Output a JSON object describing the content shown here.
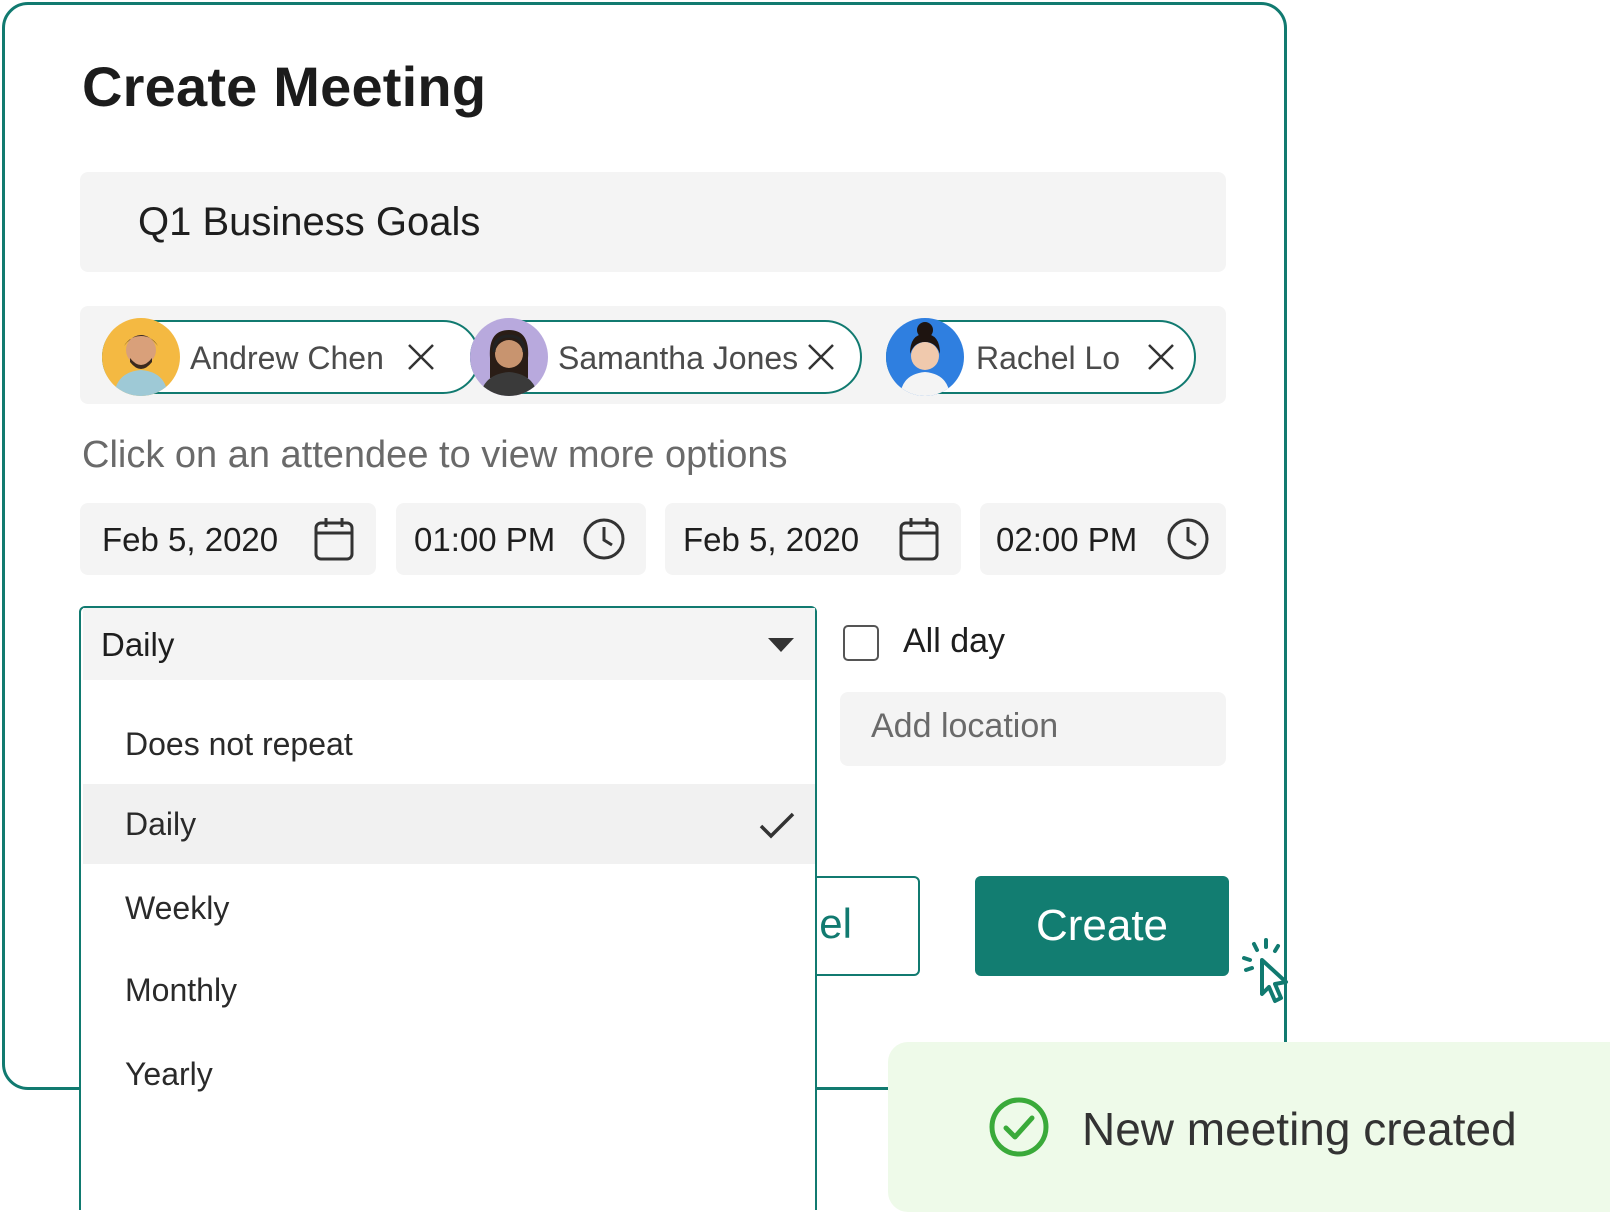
{
  "dialog": {
    "title": "Create Meeting"
  },
  "meeting_title": {
    "value": "Q1 Business Goals"
  },
  "attendees": [
    {
      "name": "Andrew Chen",
      "avatar_color": "#f4b942"
    },
    {
      "name": "Samantha Jones",
      "avatar_color": "#b8a9dd"
    },
    {
      "name": "Rachel Lo",
      "avatar_color": "#2f7fe0"
    }
  ],
  "hint": "Click on an attendee to view more options",
  "schedule": {
    "start_date": "Feb 5, 2020",
    "start_time": "01:00 PM",
    "end_date": "Feb 5, 2020",
    "end_time": "02:00 PM"
  },
  "repeat": {
    "selected": "Daily",
    "options": [
      "Does not repeat",
      "Daily",
      "Weekly",
      "Monthly",
      "Yearly"
    ]
  },
  "all_day": {
    "label": "All day",
    "checked": false
  },
  "location": {
    "placeholder": "Add location"
  },
  "buttons": {
    "cancel": "Cancel",
    "cancel_visible": "el",
    "create": "Create"
  },
  "toast": {
    "message": "New meeting created"
  },
  "colors": {
    "accent": "#127d71",
    "toast_bg": "#eefae9",
    "success": "#3aaa3a"
  }
}
